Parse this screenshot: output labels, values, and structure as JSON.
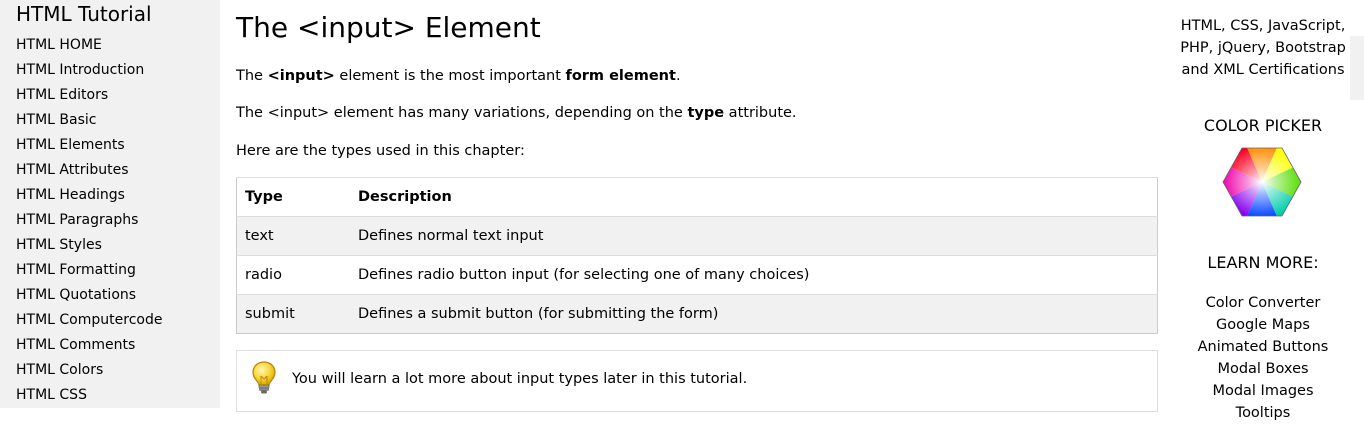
{
  "sidebar": {
    "title": "HTML Tutorial",
    "items": [
      "HTML HOME",
      "HTML Introduction",
      "HTML Editors",
      "HTML Basic",
      "HTML Elements",
      "HTML Attributes",
      "HTML Headings",
      "HTML Paragraphs",
      "HTML Styles",
      "HTML Formatting",
      "HTML Quotations",
      "HTML Computercode",
      "HTML Comments",
      "HTML Colors",
      "HTML CSS"
    ]
  },
  "main": {
    "heading": "The <input> Element",
    "p1": {
      "a": "The ",
      "b1": "<input>",
      "c": " element is the most important ",
      "b2": "form element",
      "d": "."
    },
    "p2": {
      "a": "The <input> element has many variations, depending on the ",
      "b": "type",
      "c": " attribute."
    },
    "p3": "Here are the types used in this chapter:",
    "table": {
      "headers": [
        "Type",
        "Description"
      ],
      "rows": [
        [
          "text",
          "Defines normal text input"
        ],
        [
          "radio",
          "Defines radio button input (for selecting one of many choices)"
        ],
        [
          "submit",
          "Defines a submit button (for submitting the form)"
        ]
      ]
    },
    "note": "You will learn a lot more about input types later in this tutorial."
  },
  "right": {
    "cert_lines": [
      "HTML, CSS, JavaScript,",
      "PHP, jQuery, Bootstrap",
      "and XML Certifications"
    ],
    "picker_title": "COLOR PICKER",
    "learn_title": "LEARN MORE:",
    "learn_items": [
      "Color Converter",
      "Google Maps",
      "Animated Buttons",
      "Modal Boxes",
      "Modal Images",
      "Tooltips"
    ]
  },
  "icons": {
    "note": "lightbulb-icon",
    "picker": "color-wheel-icon"
  }
}
